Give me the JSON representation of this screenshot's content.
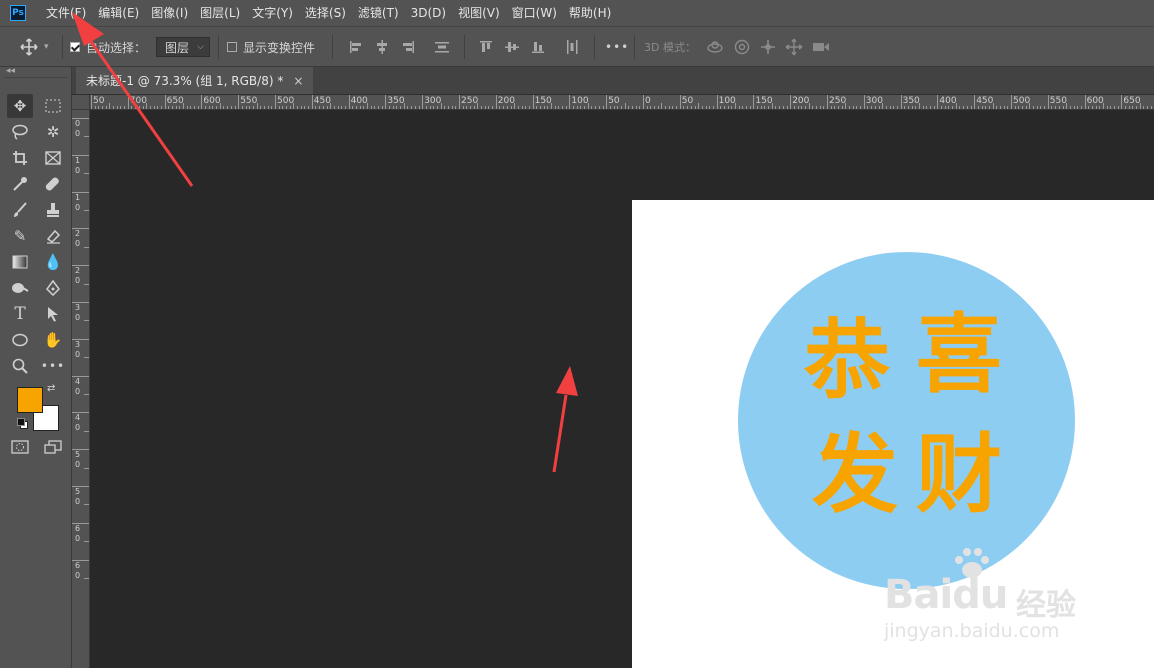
{
  "menu": {
    "logo": "Ps",
    "items": [
      "文件(F)",
      "编辑(E)",
      "图像(I)",
      "图层(L)",
      "文字(Y)",
      "选择(S)",
      "滤镜(T)",
      "3D(D)",
      "视图(V)",
      "窗口(W)",
      "帮助(H)"
    ]
  },
  "options": {
    "auto_select_label": "自动选择：",
    "auto_select_value": "图层",
    "show_transform_label": "显示变换控件",
    "more": "•••",
    "mode_3d_label": "3D 模式："
  },
  "tab": {
    "title": "未标题-1 @ 73.3% (组 1, RGB/8) *",
    "close": "×"
  },
  "ruler_h_labels": [
    "50",
    "700",
    "650",
    "600",
    "550",
    "500",
    "450",
    "400",
    "350",
    "300",
    "250",
    "200",
    "150",
    "100",
    "50",
    "0",
    "50",
    "100",
    "150",
    "200",
    "250",
    "300",
    "350",
    "400",
    "450",
    "500",
    "550",
    "600",
    "650"
  ],
  "ruler_v_labels": [
    "0",
    "1",
    "1",
    "2",
    "2",
    "3",
    "3",
    "4",
    "4",
    "5",
    "5",
    "6",
    "6"
  ],
  "canvas": {
    "glyphs": [
      "恭",
      "喜",
      "发",
      "财"
    ],
    "text_color": "#f7a400",
    "circle_color": "#8ecdf2"
  },
  "watermark": {
    "brand": "Baidu",
    "brand_cn": "经验",
    "url": "jingyan.baidu.com"
  },
  "colors": {
    "foreground": "#f7a400",
    "background": "#ffffff",
    "annotation_arrow": "#f24040"
  }
}
